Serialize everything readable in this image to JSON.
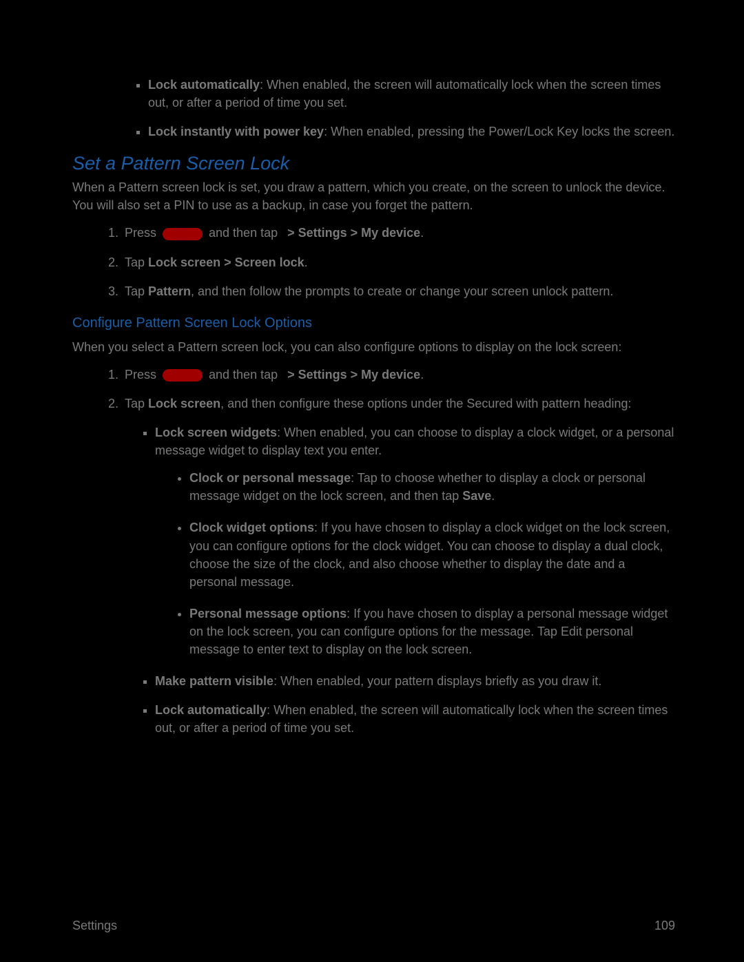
{
  "top_bullets": [
    {
      "term": "Lock automatically",
      "desc": ": When enabled, the screen will automatically lock when the screen times out, or after a period of time you set."
    },
    {
      "term": "Lock instantly with power key",
      "desc": ": When enabled, pressing the Power/Lock Key locks the screen."
    }
  ],
  "section1": {
    "title": "Set a Pattern Screen Lock",
    "intro": "When a Pattern screen lock is set, you draw a pattern, which you create, on the screen to unlock the device. You will also set a PIN to use as a backup, in case you forget the pattern.",
    "steps": {
      "s1_pre": "Press ",
      "s1_mid": " and then tap ",
      "s1_bold": " > Settings > My device",
      "s1_end": ".",
      "s2_pre": "Tap ",
      "s2_bold": "Lock screen > Screen lock",
      "s2_end": ".",
      "s3_pre": "Tap ",
      "s3_bold": "Pattern",
      "s3_end": ", and then follow the prompts to create or change your screen unlock pattern."
    }
  },
  "section2": {
    "title": "Configure Pattern Screen Lock Options",
    "intro": "When you select a Pattern screen lock, you can also configure options to display on the lock screen:",
    "steps": {
      "s1_pre": "Press ",
      "s1_mid": " and then tap ",
      "s1_bold": " > Settings > My device",
      "s1_end": ".",
      "s2_pre": "Tap ",
      "s2_bold": "Lock screen",
      "s2_end": ", and then configure these options under the Secured with pattern heading:"
    },
    "opts": {
      "o1_term": "Lock screen widgets",
      "o1_desc": ": When enabled, you can choose to display a clock widget, or a personal message widget to display text you enter.",
      "sub": {
        "a_term": "Clock or personal message",
        "a_desc_pre": ": Tap to choose whether to display a clock or personal message widget on the lock screen, and then tap ",
        "a_desc_bold": "Save",
        "a_desc_end": ".",
        "b_term": "Clock widget options",
        "b_desc": ": If you have chosen to display a clock widget on the lock screen, you can configure options for the clock widget. You can choose to display a dual clock, choose the size of the clock, and also choose whether to display the date and a personal message.",
        "c_term": "Personal message options",
        "c_desc": ": If you have chosen to display a personal message widget on the lock screen, you can configure options for the message. Tap Edit personal message to enter text to display on the lock screen."
      },
      "o2_term": "Make pattern visible",
      "o2_desc": ": When enabled, your pattern displays briefly as you draw it.",
      "o3_term": "Lock automatically",
      "o3_desc": ": When enabled, the screen will automatically lock when the screen times out, or after a period of time you set."
    }
  },
  "footer": {
    "section": "Settings",
    "page": "109"
  }
}
